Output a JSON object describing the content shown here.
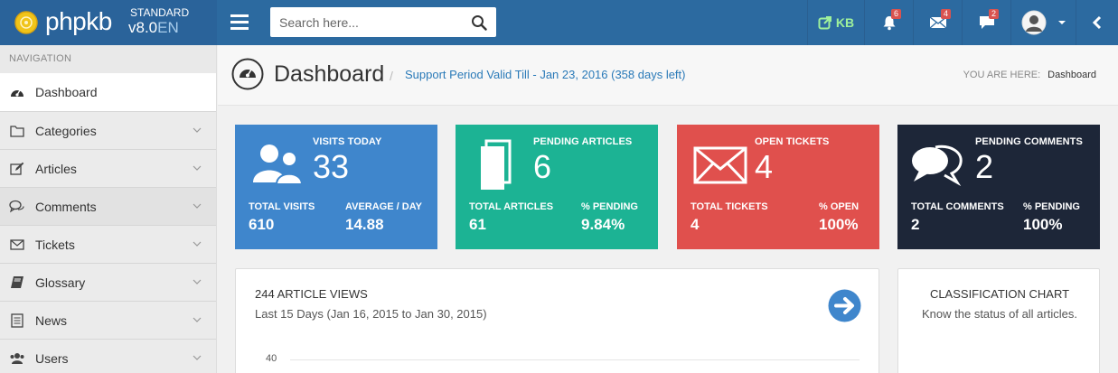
{
  "header": {
    "logo_text": "phpkb",
    "edition": "STANDARD",
    "version": "v8.0",
    "language": "EN",
    "search_placeholder": "Search here...",
    "kb_label": "KB",
    "notifications_count": "6",
    "messages_count": "4",
    "chat_count": "2",
    "icons": [
      "menu-icon",
      "search-icon",
      "external-link-icon",
      "bell-icon",
      "envelope-icon",
      "chat-icon",
      "user-avatar-icon",
      "caret-down-icon",
      "chevron-left-icon"
    ]
  },
  "sidebar": {
    "header": "NAVIGATION",
    "items": [
      {
        "label": "Dashboard",
        "icon": "dashboard-icon"
      },
      {
        "label": "Categories",
        "icon": "folder-icon"
      },
      {
        "label": "Articles",
        "icon": "edit-icon"
      },
      {
        "label": "Comments",
        "icon": "comments-icon"
      },
      {
        "label": "Tickets",
        "icon": "envelope-icon"
      },
      {
        "label": "Glossary",
        "icon": "book-icon"
      },
      {
        "label": "News",
        "icon": "newspaper-icon"
      },
      {
        "label": "Users",
        "icon": "users-icon"
      }
    ]
  },
  "page": {
    "title": "Dashboard",
    "support_period": "Support Period Valid Till - Jan 23, 2016 (358 days left)",
    "breadcrumb_label": "YOU ARE HERE:",
    "breadcrumb_current": "Dashboard"
  },
  "stats": [
    {
      "label": "VISITS TODAY",
      "value": "33",
      "k1": "TOTAL VISITS",
      "v1": "610",
      "k2": "AVERAGE / DAY",
      "v2": "14.88",
      "color": "#3f86cc",
      "icon": "users-icon"
    },
    {
      "label": "PENDING ARTICLES",
      "value": "6",
      "k1": "TOTAL ARTICLES",
      "v1": "61",
      "k2": "% PENDING",
      "v2": "9.84%",
      "color": "#1cb394",
      "icon": "documents-icon"
    },
    {
      "label": "OPEN TICKETS",
      "value": "4",
      "k1": "TOTAL TICKETS",
      "v1": "4",
      "k2": "% OPEN",
      "v2": "100%",
      "color": "#e0504d",
      "icon": "envelope-icon"
    },
    {
      "label": "PENDING COMMENTS",
      "value": "2",
      "k1": "TOTAL COMMENTS",
      "v1": "2",
      "k2": "% PENDING",
      "v2": "100%",
      "color": "#1d2638",
      "icon": "comments-icon"
    }
  ],
  "views_panel": {
    "title": "244 ARTICLE VIEWS",
    "subtitle": "Last 15 Days (Jan 16, 2015 to Jan 30, 2015)",
    "y_tick": "40",
    "go_icon": "arrow-right-icon"
  },
  "classification_panel": {
    "title": "CLASSIFICATION CHART",
    "subtitle": "Know the status of all articles."
  }
}
